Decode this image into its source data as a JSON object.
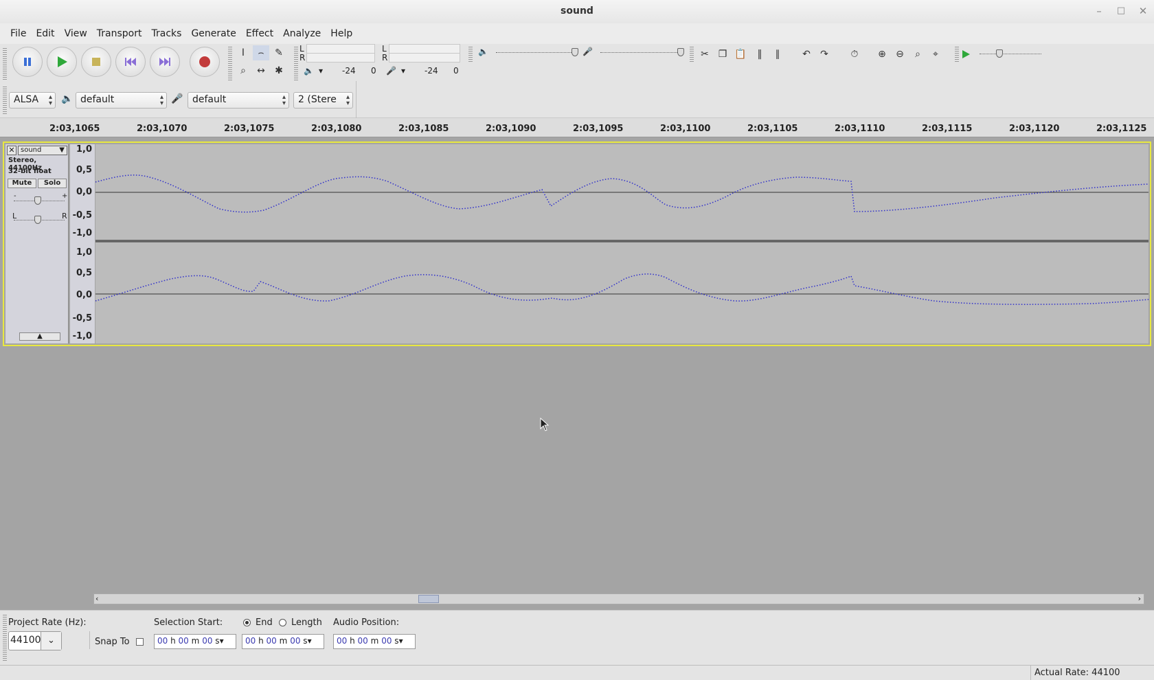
{
  "window": {
    "title": "sound"
  },
  "menu": [
    "File",
    "Edit",
    "View",
    "Transport",
    "Tracks",
    "Generate",
    "Effect",
    "Analyze",
    "Help"
  ],
  "meters": {
    "play_L": "L",
    "play_R": "R",
    "rec_L": "L",
    "rec_R": "R",
    "play_db": "-24",
    "play_zero": "0",
    "rec_db": "-24",
    "rec_zero": "0"
  },
  "device": {
    "host": "ALSA",
    "playback_device": "default",
    "recording_device": "default",
    "channels": "2 (Stere"
  },
  "ruler": {
    "labels": [
      "2:03,1065",
      "2:03,1070",
      "2:03,1075",
      "2:03,1080",
      "2:03,1085",
      "2:03,1090",
      "2:03,1095",
      "2:03,1100",
      "2:03,1105",
      "2:03,1110",
      "2:03,1115",
      "2:03,1120",
      "2:03,1125"
    ]
  },
  "track": {
    "name": "sound",
    "info1": "Stereo, 44100Hz",
    "info2": "32-bit float",
    "mute": "Mute",
    "solo": "Solo",
    "gain_minus": "-",
    "gain_plus": "+",
    "pan_left": "L",
    "pan_right": "R",
    "scale": [
      "1,0",
      "0,5",
      "0,0",
      "-0,5",
      "-1,0"
    ],
    "waveform_color": "#2e2ecc"
  },
  "selection": {
    "rate_label": "Project Rate (Hz):",
    "rate_value": "44100",
    "snap_label": "Snap To",
    "start_label": "Selection Start:",
    "end_label": "End",
    "length_label": "Length",
    "position_label": "Audio Position:",
    "time_h": "00",
    "time_m": "00",
    "time_s": "00",
    "unit_h": "h",
    "unit_m": "m",
    "unit_s": "s"
  },
  "status": {
    "actual_rate": "Actual Rate: 44100"
  }
}
